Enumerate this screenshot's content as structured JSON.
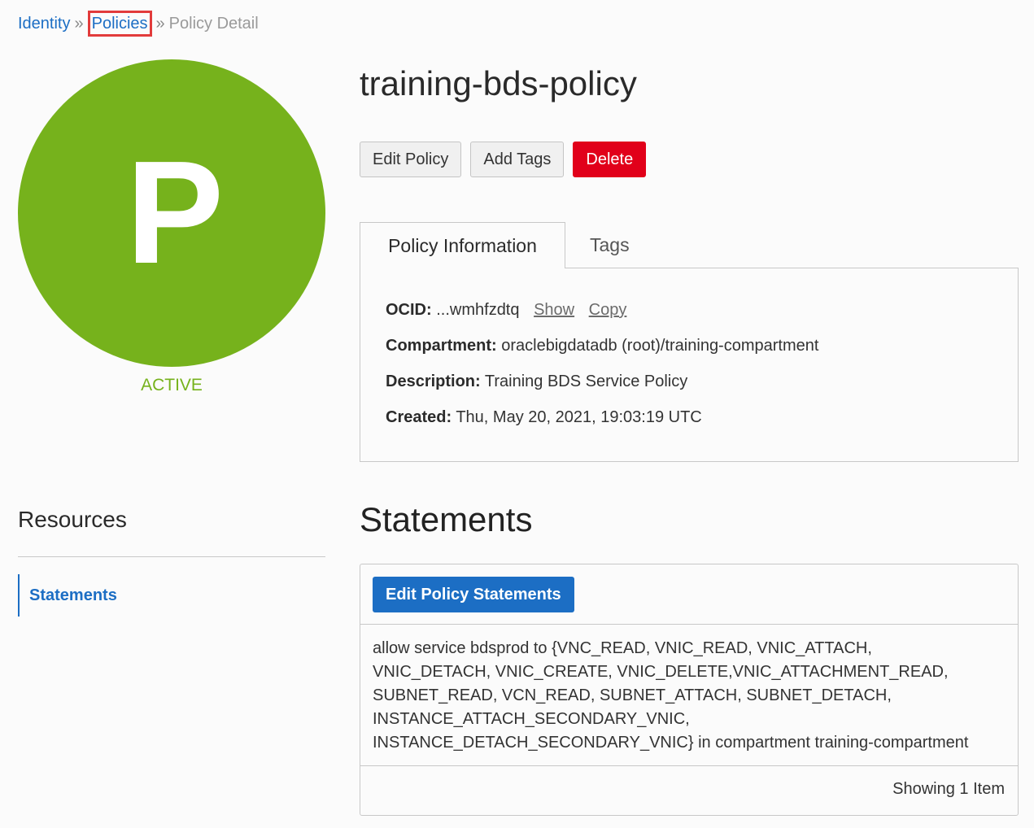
{
  "breadcrumb": {
    "items": [
      "Identity",
      "Policies",
      "Policy Detail"
    ],
    "separator": "»"
  },
  "avatar": {
    "letter": "P",
    "color": "#76b21c",
    "status": "ACTIVE"
  },
  "policy": {
    "title": "training-bds-policy"
  },
  "actions": {
    "edit_label": "Edit Policy",
    "add_tags_label": "Add Tags",
    "delete_label": "Delete"
  },
  "tabs": [
    {
      "label": "Policy Information",
      "active": true
    },
    {
      "label": "Tags",
      "active": false
    }
  ],
  "info": {
    "ocid_label": "OCID:",
    "ocid_value": "...wmhfzdtq",
    "show_link": "Show",
    "copy_link": "Copy",
    "compartment_label": "Compartment:",
    "compartment_value": "oraclebigdatadb (root)/training-compartment",
    "description_label": "Description:",
    "description_value": "Training BDS Service Policy",
    "created_label": "Created:",
    "created_value": "Thu, May 20, 2021, 19:03:19 UTC"
  },
  "resources": {
    "title": "Resources",
    "items": [
      {
        "label": "Statements",
        "active": true
      }
    ]
  },
  "statements": {
    "title": "Statements",
    "edit_button": "Edit Policy Statements",
    "lines": [
      "allow service bdsprod to {VNC_READ, VNIC_READ, VNIC_ATTACH,",
      "VNIC_DETACH, VNIC_CREATE, VNIC_DELETE,VNIC_ATTACHMENT_READ,",
      "SUBNET_READ, VCN_READ, SUBNET_ATTACH, SUBNET_DETACH,",
      "INSTANCE_ATTACH_SECONDARY_VNIC,",
      "INSTANCE_DETACH_SECONDARY_VNIC} in compartment training-compartment"
    ],
    "showing": "Showing 1 Item"
  },
  "colors": {
    "link": "#1c6ec4",
    "danger": "#e1001a",
    "active_green": "#76b21c",
    "highlight_box": "#e23b3b"
  }
}
